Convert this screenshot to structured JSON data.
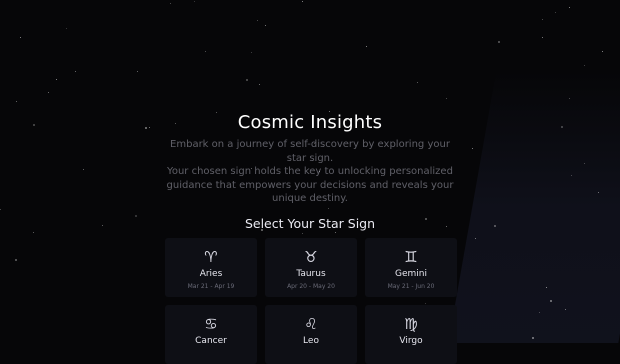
{
  "page": {
    "title": "Cosmic Insights",
    "intro_line1": "Embark on a journey of self-discovery by exploring your star sign.",
    "intro_line2": "Your chosen sign holds the key to unlocking personalized guidance that empowers your decisions and reveals your unique destiny.",
    "section_title": "Select Your Star Sign"
  },
  "signs": [
    {
      "name": "Aries",
      "dates": "Mar 21 - Apr 19",
      "icon": "aries-icon",
      "glyph": "♈︎"
    },
    {
      "name": "Taurus",
      "dates": "Apr 20 - May 20",
      "icon": "taurus-icon",
      "glyph": "♉︎"
    },
    {
      "name": "Gemini",
      "dates": "May 21 - Jun 20",
      "icon": "gemini-icon",
      "glyph": "♊︎"
    },
    {
      "name": "Cancer",
      "dates": "",
      "icon": "cancer-icon",
      "glyph": "♋︎"
    },
    {
      "name": "Leo",
      "dates": "",
      "icon": "leo-icon",
      "glyph": "♌︎"
    },
    {
      "name": "Virgo",
      "dates": "",
      "icon": "virgo-icon",
      "glyph": "♍︎"
    }
  ],
  "colors": {
    "background": "#060608",
    "card": "#0e0f15",
    "text": "#ffffff",
    "muted": "#6a6b78"
  }
}
